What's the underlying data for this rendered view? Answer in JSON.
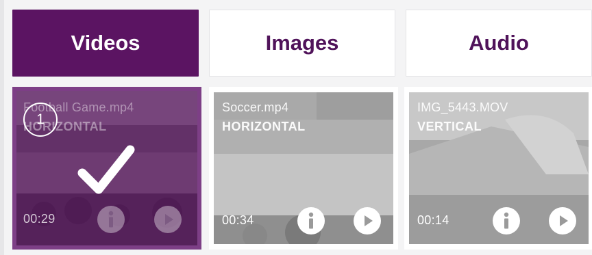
{
  "tabs": {
    "videos": "Videos",
    "images": "Images",
    "audio": "Audio",
    "active": "videos"
  },
  "media": [
    {
      "name": "Football Game.mp4",
      "orientation": "HORIZONTAL",
      "duration": "00:29",
      "selected": true,
      "selection_index": "1"
    },
    {
      "name": "Soccer.mp4",
      "orientation": "HORIZONTAL",
      "duration": "00:34",
      "selected": false
    },
    {
      "name": "IMG_5443.MOV",
      "orientation": "VERTICAL",
      "duration": "00:14",
      "selected": false
    }
  ],
  "icons": {
    "info": "info-icon",
    "play": "play-icon",
    "check": "checkmark-icon"
  },
  "colors": {
    "accent": "#5b1462",
    "accent_text": "#50135a",
    "selection_border": "#7d3f86"
  }
}
